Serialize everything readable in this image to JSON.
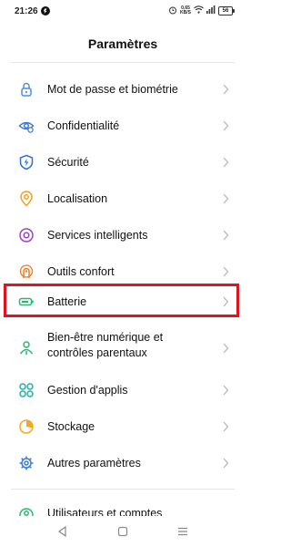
{
  "status": {
    "time": "21:26",
    "net_top": "0,65",
    "net_bottom": "KB/S",
    "battery": "56"
  },
  "header": {
    "title": "Paramètres"
  },
  "items": [
    {
      "label": "Mot de passe et biométrie",
      "icon": "lock-icon",
      "color": "#4a90e2"
    },
    {
      "label": "Confidentialité",
      "icon": "privacy-eye-icon",
      "color": "#3a7bd5"
    },
    {
      "label": "Sécurité",
      "icon": "shield-bolt-icon",
      "color": "#2f6fd6"
    },
    {
      "label": "Localisation",
      "icon": "location-pin-icon",
      "color": "#f0a020"
    },
    {
      "label": "Services intelligents",
      "icon": "smart-services-icon",
      "color": "#a040c8"
    },
    {
      "label": "Outils confort",
      "icon": "hand-tools-icon",
      "color": "#f07a20"
    },
    {
      "label": "Batterie",
      "icon": "battery-icon",
      "color": "#2bb673"
    },
    {
      "label": "Bien-être numérique et contrôles parentaux",
      "icon": "wellbeing-icon",
      "color": "#2bb673"
    },
    {
      "label": "Gestion d'applis",
      "icon": "apps-grid-icon",
      "color": "#20b2aa"
    },
    {
      "label": "Stockage",
      "icon": "storage-pie-icon",
      "color": "#f5a623"
    },
    {
      "label": "Autres paramètres",
      "icon": "gear-icon",
      "color": "#3a7bd5"
    },
    {
      "label": "Utilisateurs et comptes",
      "icon": "user-icon",
      "color": "#2bb673"
    }
  ]
}
